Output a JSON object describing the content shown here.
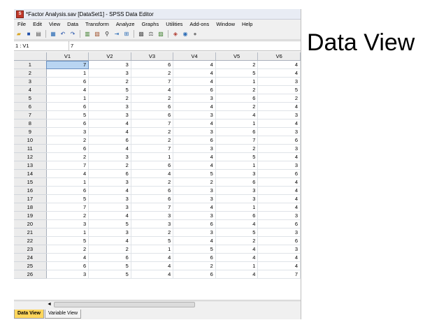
{
  "slide": {
    "title": "Data View"
  },
  "window": {
    "title": "*Factor Analysis.sav [DataSet1] - SPSS Data Editor"
  },
  "menu": [
    "File",
    "Edit",
    "View",
    "Data",
    "Transform",
    "Analyze",
    "Graphs",
    "Utilities",
    "Add-ons",
    "Window",
    "Help"
  ],
  "toolbar_icons": [
    "open-folder-icon",
    "save-icon",
    "print-icon",
    "dialog-recall-icon",
    "undo-icon",
    "redo-icon",
    "goto-case-icon",
    "variables-icon",
    "find-icon",
    "insert-cases-icon",
    "insert-variable-icon",
    "split-file-icon",
    "weight-cases-icon",
    "select-cases-icon",
    "value-labels-icon",
    "use-sets-icon",
    "show-all-icon"
  ],
  "cell_editor": {
    "ref": "1 : V1",
    "value": "7"
  },
  "columns": [
    "V1",
    "V2",
    "V3",
    "V4",
    "V5",
    "V6"
  ],
  "rows": [
    {
      "n": "1",
      "v": [
        "7",
        "3",
        "6",
        "4",
        "2",
        "4"
      ]
    },
    {
      "n": "2",
      "v": [
        "1",
        "3",
        "2",
        "4",
        "5",
        "4"
      ]
    },
    {
      "n": "3",
      "v": [
        "6",
        "2",
        "7",
        "4",
        "1",
        "3"
      ]
    },
    {
      "n": "4",
      "v": [
        "4",
        "5",
        "4",
        "6",
        "2",
        "5"
      ]
    },
    {
      "n": "5",
      "v": [
        "1",
        "2",
        "2",
        "3",
        "6",
        "2"
      ]
    },
    {
      "n": "6",
      "v": [
        "6",
        "3",
        "6",
        "4",
        "2",
        "4"
      ]
    },
    {
      "n": "7",
      "v": [
        "5",
        "3",
        "6",
        "3",
        "4",
        "3"
      ]
    },
    {
      "n": "8",
      "v": [
        "6",
        "4",
        "7",
        "4",
        "1",
        "4"
      ]
    },
    {
      "n": "9",
      "v": [
        "3",
        "4",
        "2",
        "3",
        "6",
        "3"
      ]
    },
    {
      "n": "10",
      "v": [
        "2",
        "6",
        "2",
        "6",
        "7",
        "6"
      ]
    },
    {
      "n": "11",
      "v": [
        "6",
        "4",
        "7",
        "3",
        "2",
        "3"
      ]
    },
    {
      "n": "12",
      "v": [
        "2",
        "3",
        "1",
        "4",
        "5",
        "4"
      ]
    },
    {
      "n": "13",
      "v": [
        "7",
        "2",
        "6",
        "4",
        "1",
        "3"
      ]
    },
    {
      "n": "14",
      "v": [
        "4",
        "6",
        "4",
        "5",
        "3",
        "6"
      ]
    },
    {
      "n": "15",
      "v": [
        "1",
        "3",
        "2",
        "2",
        "6",
        "4"
      ]
    },
    {
      "n": "16",
      "v": [
        "6",
        "4",
        "6",
        "3",
        "3",
        "4"
      ]
    },
    {
      "n": "17",
      "v": [
        "5",
        "3",
        "6",
        "3",
        "3",
        "4"
      ]
    },
    {
      "n": "18",
      "v": [
        "7",
        "3",
        "7",
        "4",
        "1",
        "4"
      ]
    },
    {
      "n": "19",
      "v": [
        "2",
        "4",
        "3",
        "3",
        "6",
        "3"
      ]
    },
    {
      "n": "20",
      "v": [
        "3",
        "5",
        "3",
        "6",
        "4",
        "6"
      ]
    },
    {
      "n": "21",
      "v": [
        "1",
        "3",
        "2",
        "3",
        "5",
        "3"
      ]
    },
    {
      "n": "22",
      "v": [
        "5",
        "4",
        "5",
        "4",
        "2",
        "6"
      ]
    },
    {
      "n": "23",
      "v": [
        "2",
        "2",
        "1",
        "5",
        "4",
        "3"
      ]
    },
    {
      "n": "24",
      "v": [
        "4",
        "6",
        "4",
        "6",
        "4",
        "4"
      ]
    },
    {
      "n": "25",
      "v": [
        "6",
        "5",
        "4",
        "2",
        "1",
        "4"
      ]
    },
    {
      "n": "26",
      "v": [
        "3",
        "5",
        "4",
        "6",
        "4",
        "7"
      ]
    }
  ],
  "selected_cell": {
    "row": "1",
    "column": "V1"
  },
  "tabs": [
    {
      "label": "Data View",
      "active": true
    },
    {
      "label": "Variable View",
      "active": false
    }
  ],
  "colors": {
    "active_tab": "#ffd65c",
    "selected_cell": "#b9d5f2",
    "header_bg": "#ececec"
  }
}
